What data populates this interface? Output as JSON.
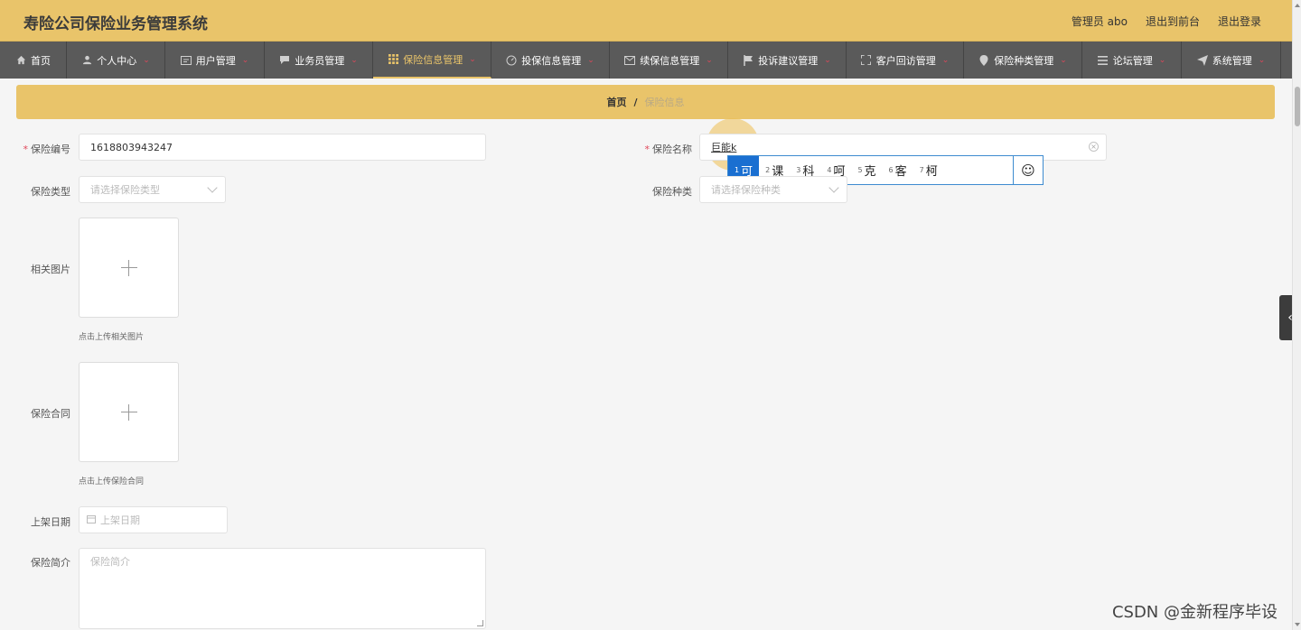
{
  "header": {
    "title": "寿险公司保险业务管理系统",
    "admin_label": "管理员 abo",
    "back_to_front": "退出到前台",
    "logout": "退出登录"
  },
  "nav": {
    "items": [
      {
        "label": "首页",
        "icon": "home-icon"
      },
      {
        "label": "个人中心",
        "icon": "user-icon"
      },
      {
        "label": "用户管理",
        "icon": "id-card-icon"
      },
      {
        "label": "业务员管理",
        "icon": "chat-icon"
      },
      {
        "label": "保险信息管理",
        "icon": "grid-icon",
        "active": true
      },
      {
        "label": "投保信息管理",
        "icon": "gauge-icon"
      },
      {
        "label": "续保信息管理",
        "icon": "mail-icon"
      },
      {
        "label": "投诉建议管理",
        "icon": "flag-icon"
      },
      {
        "label": "客户回访管理",
        "icon": "fullscreen-icon"
      },
      {
        "label": "保险种类管理",
        "icon": "location-icon"
      },
      {
        "label": "论坛管理",
        "icon": "menu-icon"
      },
      {
        "label": "系统管理",
        "icon": "send-icon"
      }
    ],
    "accent_color": "#e9c46a",
    "caret_color": "#e0475a"
  },
  "breadcrumb": {
    "home": "首页",
    "separator": "/",
    "current": "保险信息"
  },
  "form": {
    "insurance_no": {
      "label": "保险编号",
      "value": "1618803943247"
    },
    "insurance_name": {
      "label": "保险名称",
      "value": "巨能k"
    },
    "insurance_type": {
      "label": "保险类型",
      "placeholder": "请选择保险类型"
    },
    "insurance_kind": {
      "label": "保险种类",
      "placeholder": "请选择保险种类"
    },
    "related_images": {
      "label": "相关图片",
      "hint": "点击上传相关图片"
    },
    "contract": {
      "label": "保险合同",
      "hint": "点击上传保险合同"
    },
    "listing_date": {
      "label": "上架日期",
      "placeholder": "上架日期"
    },
    "description": {
      "label": "保险简介",
      "placeholder": "保险简介"
    }
  },
  "ime": {
    "candidates": [
      {
        "num": "1",
        "text": "可"
      },
      {
        "num": "2",
        "text": "课"
      },
      {
        "num": "3",
        "text": "科"
      },
      {
        "num": "4",
        "text": "呵"
      },
      {
        "num": "5",
        "text": "克"
      },
      {
        "num": "6",
        "text": "客"
      },
      {
        "num": "7",
        "text": "柯"
      }
    ],
    "emoji": "☺"
  },
  "watermark": "CSDN @金新程序毕设"
}
